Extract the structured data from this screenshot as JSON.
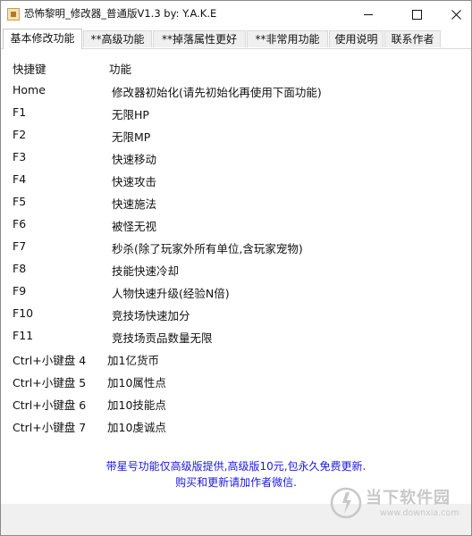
{
  "window": {
    "title": "恐怖黎明_修改器_普通版V1.3 by: Y.A.K.E"
  },
  "tabs": [
    {
      "label": "基本修改功能",
      "active": true
    },
    {
      "label": "**高级功能",
      "active": false
    },
    {
      "label": "**掉落属性更好",
      "active": false
    },
    {
      "label": "**非常用功能",
      "active": false
    },
    {
      "label": "使用说明",
      "active": false
    },
    {
      "label": "联系作者",
      "active": false
    }
  ],
  "table": {
    "headers": {
      "key": "快捷键",
      "func": "功能"
    },
    "rows": [
      {
        "key": "Home",
        "func": "修改器初始化(请先初始化再使用下面功能)"
      },
      {
        "key": "F1",
        "func": "无限HP"
      },
      {
        "key": "F2",
        "func": "无限MP"
      },
      {
        "key": "F3",
        "func": "快速移动"
      },
      {
        "key": "F4",
        "func": "快速攻击"
      },
      {
        "key": "F5",
        "func": "快速施法"
      },
      {
        "key": "F6",
        "func": "被怪无视"
      },
      {
        "key": "F7",
        "func": "秒杀(除了玩家外所有单位,含玩家宠物)"
      },
      {
        "key": "F8",
        "func": "技能快速冷却"
      },
      {
        "key": "F9",
        "func": "人物快速升级(经验N倍)"
      },
      {
        "key": "F10",
        "func": "竞技场快速加分"
      },
      {
        "key": "F11",
        "func": "竞技场贡品数量无限"
      },
      {
        "key": "Ctrl+小键盘 4",
        "func": "加1亿货币"
      },
      {
        "key": "Ctrl+小键盘 5",
        "func": "加10属性点"
      },
      {
        "key": "Ctrl+小键盘 6",
        "func": "加10技能点"
      },
      {
        "key": "Ctrl+小键盘 7",
        "func": "加10虔诚点"
      }
    ]
  },
  "notes": [
    "带星号功能仅高级版提供,高级版10元,包永久免费更新.",
    "购买和更新请加作者微信."
  ],
  "watermark": {
    "title": "当下软件园",
    "url": "www.downxia.com"
  },
  "colors": {
    "note_text": "#1a1ae6",
    "status_bar": "#f0f0f0",
    "watermark": "#c8c8c8"
  }
}
